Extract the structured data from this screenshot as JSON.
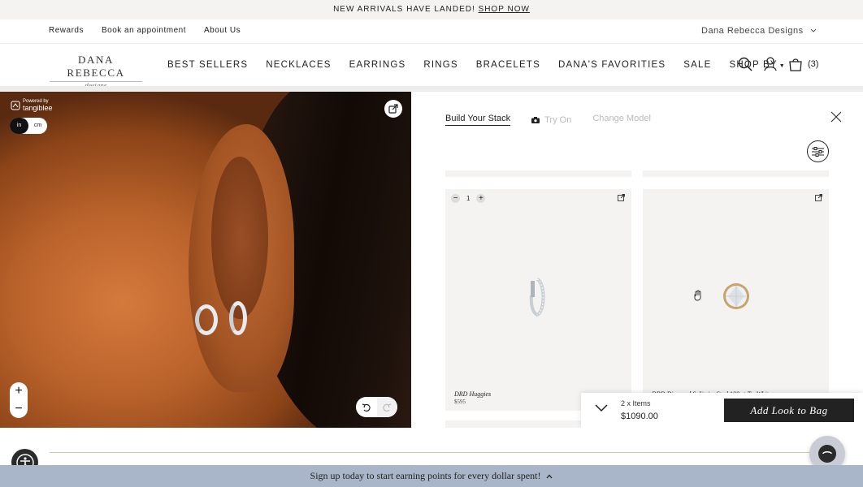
{
  "announcement": {
    "text": "NEW ARRIVALS HAVE LANDED!",
    "link": "SHOP NOW"
  },
  "utility_nav": {
    "links": [
      "Rewards",
      "Book an appointment",
      "About Us"
    ],
    "store_selector": "Dana Rebecca Designs"
  },
  "logo": {
    "line1": "DANA REBECCA",
    "line2": "designs"
  },
  "main_nav": {
    "items": [
      "BEST SELLERS",
      "NECKLACES",
      "EARRINGS",
      "RINGS",
      "BRACELETS",
      "DANA'S FAVORITIES",
      "SALE",
      "SHOP BY"
    ],
    "cart_count": "(3)"
  },
  "viewer": {
    "powered_by": "Powered by",
    "powered_name": "tangiblee",
    "unit_in": "in",
    "unit_cm": "cm",
    "zoom_in": "+",
    "zoom_out": "−"
  },
  "panel": {
    "tabs": {
      "build": "Build Your Stack",
      "try_on": "Try On",
      "change_model": "Change Model"
    },
    "products": [
      {
        "name": "DRD Huggies",
        "price": "$595",
        "qty": "1",
        "minus": "−",
        "plus": "+"
      },
      {
        "name": "DRD Diamond Solitaire Stud 100 ct Tw White",
        "price": ""
      }
    ]
  },
  "bag_bar": {
    "items": "2 x Items",
    "total": "$1090.00",
    "button": "Add Look to Bag"
  },
  "signup_banner": "Sign up today to start earning points for every dollar spent!",
  "colors": {
    "accent_dark": "#222222",
    "signup_bg": "#a9b6c9",
    "gold_line": "#d9c3a3",
    "card_bg": "#f4f3f1"
  }
}
